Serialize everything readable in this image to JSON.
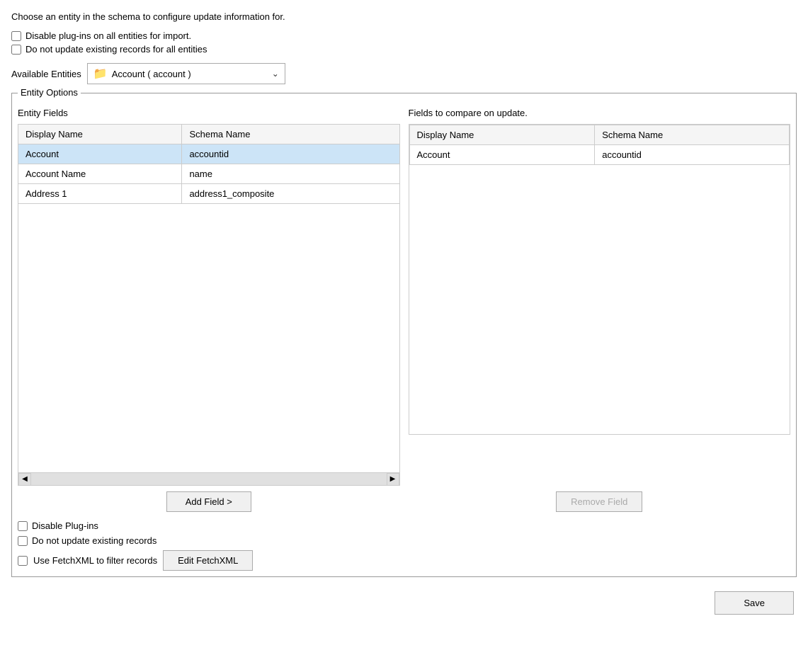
{
  "intro": {
    "text": "Choose an entity in the schema to configure update information for."
  },
  "global_options": {
    "disable_plugins_label": "Disable plug-ins on all entities for import.",
    "do_not_update_label": "Do not update existing records for all entities"
  },
  "available_entities": {
    "label": "Available Entities",
    "selected": "Account  (  account  )",
    "folder_icon": "📁"
  },
  "entity_options": {
    "legend": "Entity Options",
    "entity_fields_title": "Entity Fields",
    "fields_to_compare_title": "Fields to compare on update.",
    "left_table": {
      "col1": "Display Name",
      "col2": "Schema Name",
      "rows": [
        {
          "display": "Account",
          "schema": "accountid",
          "selected": true
        },
        {
          "display": "Account Name",
          "schema": "name",
          "selected": false
        },
        {
          "display": "Address 1",
          "schema": "address1_composite",
          "selected": false
        }
      ]
    },
    "right_table": {
      "col1": "Display Name",
      "col2": "Schema Name",
      "rows": [
        {
          "display": "Account",
          "schema": "accountid"
        }
      ]
    }
  },
  "buttons": {
    "add_field": "Add Field >",
    "remove_field": "Remove Field"
  },
  "entity_bottom_options": {
    "disable_plugins_label": "Disable Plug-ins",
    "do_not_update_label": "Do not update existing records",
    "use_fetchxml_label": "Use FetchXML to filter records",
    "edit_fetchxml_label": "Edit FetchXML"
  },
  "footer": {
    "save_label": "Save"
  }
}
